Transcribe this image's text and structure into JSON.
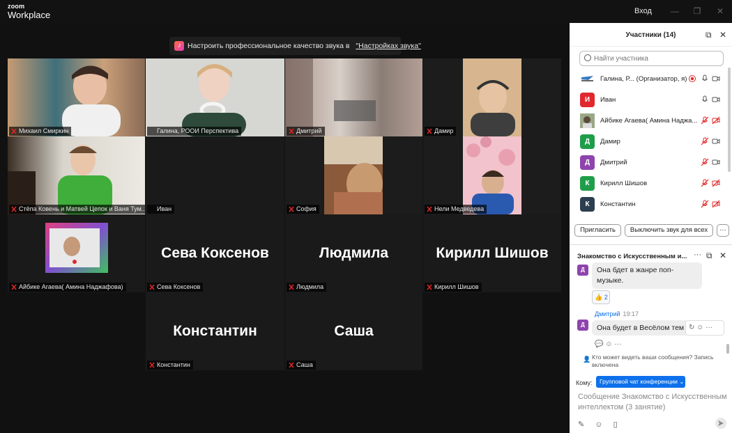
{
  "app": {
    "brand_small": "zoom",
    "brand_large": "Workplace",
    "signin": "Вход"
  },
  "banner": {
    "text": "Настроить профессиональное качество звука в",
    "link": "\"Настройках звука\""
  },
  "tiles": [
    {
      "name": "Михаил Смиркин"
    },
    {
      "name": "Галина, РООИ Перспектива"
    },
    {
      "name": "Дмитрий"
    },
    {
      "name": "Дамир"
    },
    {
      "name": "Стёпа Ковень и Матвей Цепок и Ваня Тум..."
    },
    {
      "name": "Иван"
    },
    {
      "name": "София"
    },
    {
      "name": "Нели Медведева"
    },
    {
      "name": "Айбике Агаева( Амина Наджафова)"
    },
    {
      "name": "Сева Коксенов",
      "big": "Сева Коксенов"
    },
    {
      "name": "Людмила",
      "big": "Людмила"
    },
    {
      "name": "Кирилл Шишов",
      "big": "Кирилл Шишов"
    },
    {
      "name": "Константин",
      "big": "Константин"
    },
    {
      "name": "Саша",
      "big": "Саша"
    }
  ],
  "participants": {
    "title": "Участники (14)",
    "search_placeholder": "Найти участника",
    "items": [
      {
        "initial": "",
        "name": "Галина, Р... (Организатор, я)",
        "color": "#ffffff"
      },
      {
        "initial": "И",
        "name": "Иван",
        "color": "#e0282e"
      },
      {
        "initial": "",
        "name": "Айбике Агаева( Амина Наджа...",
        "color": "#7a8a6a"
      },
      {
        "initial": "Д",
        "name": "Дамир",
        "color": "#1f9e4a"
      },
      {
        "initial": "Д",
        "name": "Дмитрий",
        "color": "#8e44ad"
      },
      {
        "initial": "К",
        "name": "Кирилл Шишов",
        "color": "#1f9e4a"
      },
      {
        "initial": "К",
        "name": "Константин",
        "color": "#2c3e50"
      }
    ],
    "invite": "Пригласить",
    "mute_all": "Выключить звук для всех",
    "more": "···"
  },
  "chat": {
    "title": "Знакомство с Искусственным и...",
    "msg1": "Она бдет в жанре поп-музыке.",
    "reaction": "👍 2",
    "sender": "Дмитрий",
    "time": "19:17",
    "sender_initial": "Д",
    "msg2": "Она будет в Весёлом тем",
    "who_can_see": "Кто может видеть ваши сообщения? Запись включена",
    "to_label": "Кому:",
    "to_value": "Групповой чат конференции",
    "input_placeholder": "Сообщение Знакомство с Искусственным интеллектом (3 занятие)"
  }
}
